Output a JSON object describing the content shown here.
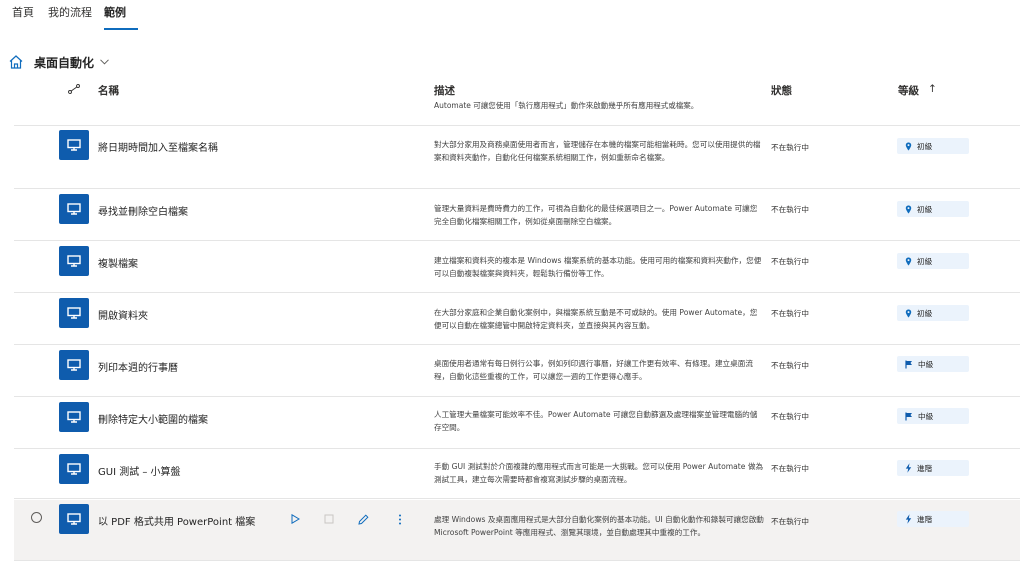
{
  "tabs": [
    {
      "label": "首頁",
      "active": false
    },
    {
      "label": "我的流程",
      "active": false
    },
    {
      "label": "範例",
      "active": true
    }
  ],
  "breadcrumb": {
    "title": "桌面自動化",
    "icon": "home-icon",
    "dropdown_icon": "chevron-down-icon"
  },
  "columns": {
    "name": "名稱",
    "description": "描述",
    "status": "狀態",
    "level": "等級",
    "level_sort_icon": "↑"
  },
  "partial_row_text": "Automate 可讓您使用「執行應用程式」動作來啟動幾乎所有應用程式或檔案。",
  "rows": [
    {
      "name": "將日期時間加入至檔案名稱",
      "description": "對大部分家用及商務桌面使用者而言，管理儲存在本機的檔案可能相當耗時。您可以使用提供的檔案和資料夾動作，自動化任何檔案系統相關工作，例如重新命名檔案。",
      "status": "不在執行中",
      "level": "初級",
      "level_icon": "pin-icon"
    },
    {
      "name": "尋找並刪除空白檔案",
      "description": "管理大量資料是費時費力的工作，可視為自動化的最佳候選項目之一。Power Automate 可讓您完全自動化檔案相關工作，例如從桌面刪除空白檔案。",
      "status": "不在執行中",
      "level": "初級",
      "level_icon": "pin-icon"
    },
    {
      "name": "複製檔案",
      "description": "建立檔案和資料夾的複本是 Windows 檔案系統的基本功能。使用可用的檔案和資料夾動作，您便可以自動複製檔案與資料夾，輕鬆執行備份等工作。",
      "status": "不在執行中",
      "level": "初級",
      "level_icon": "pin-icon"
    },
    {
      "name": "開啟資料夾",
      "description": "在大部分家庭和企業自動化案例中，與檔案系統互動是不可或缺的。使用 Power Automate，您便可以自動在檔案總管中開啟特定資料夾，並直接與其內容互動。",
      "status": "不在執行中",
      "level": "初級",
      "level_icon": "pin-icon"
    },
    {
      "name": "列印本週的行事曆",
      "description": "桌面使用者通常有每日例行公事，例如列印週行事曆，好讓工作更有效率、有條理。建立桌面流程，自動化這些重複的工作，可以讓您一週的工作更得心應手。",
      "status": "不在執行中",
      "level": "中級",
      "level_icon": "flag-icon"
    },
    {
      "name": "刪除特定大小範圍的檔案",
      "description": "人工管理大量檔案可能效率不佳。Power Automate 可讓您自動篩選及處理檔案並管理電腦的儲存空間。",
      "status": "不在執行中",
      "level": "中級",
      "level_icon": "flag-icon"
    },
    {
      "name": "GUI 測試 – 小算盤",
      "description": "手動 GUI 測試對於介面複雜的應用程式而言可能是一大挑戰。您可以使用 Power Automate 做為測試工具，建立每次需要時都會複寫測試步驟的桌面流程。",
      "status": "不在執行中",
      "level": "進階",
      "level_icon": "bolt-icon"
    },
    {
      "name": "以 PDF 格式共用 PowerPoint 檔案",
      "description": "處理 Windows 及桌面應用程式是大部分自動化案例的基本功能。UI 自動化動作和錄製可讓您啟動 Microsoft PowerPoint 等應用程式、瀏覽其環境，並自動處理其中重複的工作。",
      "status": "不在執行中",
      "level": "進階",
      "level_icon": "bolt-icon",
      "selected": true
    }
  ],
  "colors": {
    "accent": "#0f6cbd",
    "flow_icon_bg": "#0f5cad",
    "level_badge_bg": "#ebf3fc",
    "selected_row_bg": "#f3f2f1"
  }
}
